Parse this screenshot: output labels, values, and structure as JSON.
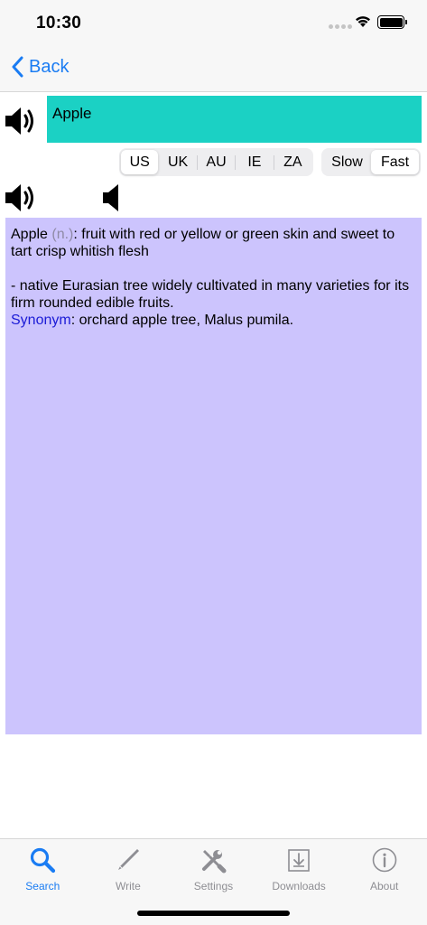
{
  "status_bar": {
    "time": "10:30"
  },
  "nav": {
    "back_label": "Back"
  },
  "search": {
    "value": "Apple"
  },
  "accents": {
    "options": [
      "US",
      "UK",
      "AU",
      "IE",
      "ZA"
    ],
    "selected": "US"
  },
  "speed": {
    "options": [
      "Slow",
      "Fast"
    ],
    "selected": "Fast"
  },
  "definition": {
    "word": "Apple",
    "pos": "(n.)",
    "sense1": ": fruit with red or yellow or green skin and sweet to tart crisp whitish flesh",
    "sense2": "- native Eurasian tree widely cultivated in many varieties for its firm rounded edible fruits.",
    "synonym_label": "Synonym",
    "synonym_text": ": orchard apple tree, Malus pumila."
  },
  "tabs": [
    {
      "label": "Search",
      "icon": "magnifier-icon",
      "active": true
    },
    {
      "label": "Write",
      "icon": "pencil-icon",
      "active": false
    },
    {
      "label": "Settings",
      "icon": "wrench-screwdriver-icon",
      "active": false
    },
    {
      "label": "Downloads",
      "icon": "download-tray-icon",
      "active": false
    },
    {
      "label": "About",
      "icon": "info-icon",
      "active": false
    }
  ],
  "colors": {
    "accent": "#1a7cf3",
    "search_bg": "#1bd1c4",
    "definition_bg": "#ccc4fd",
    "synonym": "#1b1bd6"
  }
}
